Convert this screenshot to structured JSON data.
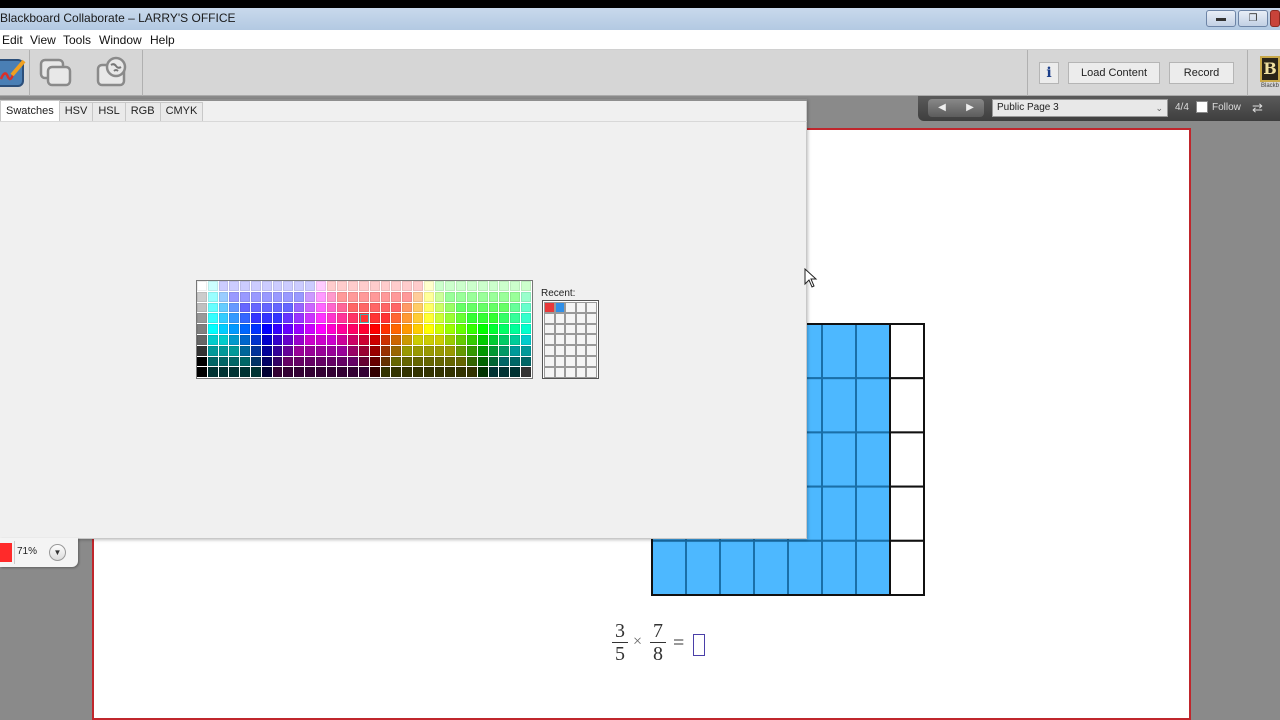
{
  "window": {
    "title": "Blackboard Collaborate – LARRY'S OFFICE",
    "controls": [
      "minimize",
      "restore",
      "close"
    ]
  },
  "menu": {
    "items": [
      "Edit",
      "View",
      "Tools",
      "Window",
      "Help"
    ]
  },
  "toolbar": {
    "icons": [
      "whiteboard-icon",
      "application-sharing-icon",
      "web-tour-icon"
    ],
    "info_label": "i",
    "load_content_label": "Load Content",
    "record_label": "Record",
    "logo_text": "B",
    "logo_sub": "Blackb"
  },
  "navigation": {
    "prev_label": "◀",
    "next_label": "▶",
    "page_select_value": "Public Page 3",
    "page_count": "4/4",
    "follow_label": "Follow",
    "follow_checked": false
  },
  "color_chooser": {
    "tabs": [
      {
        "label": "Swatches",
        "active": true
      },
      {
        "label": "HSV",
        "active": false
      },
      {
        "label": "HSL",
        "active": false
      },
      {
        "label": "RGB",
        "active": false
      },
      {
        "label": "CMYK",
        "active": false
      }
    ],
    "selected_swatch": {
      "row": 3,
      "col": 15
    },
    "recent_label": "Recent:",
    "recent_colors": [
      "#e8383a",
      "#2f8fe8"
    ],
    "swatches": [
      [
        "#ffffff",
        "#ccffff",
        "#ccccff",
        "#ccccff",
        "#ccccff",
        "#ccccff",
        "#ccccff",
        "#ccccff",
        "#ccccff",
        "#ccccff",
        "#ccccff",
        "#ffccff",
        "#ffcccc",
        "#ffcccc",
        "#ffcccc",
        "#ffcccc",
        "#ffcccc",
        "#ffcccc",
        "#ffcccc",
        "#ffcccc",
        "#ffcccc",
        "#ffffcc",
        "#ccffcc",
        "#ccffcc",
        "#ccffcc",
        "#ccffcc",
        "#ccffcc",
        "#ccffcc",
        "#ccffcc",
        "#ccffcc",
        "#ccffcc"
      ],
      [
        "#cccccc",
        "#99ffff",
        "#99ccff",
        "#9999ff",
        "#9999ff",
        "#9999ff",
        "#9999ff",
        "#9999ff",
        "#9999ff",
        "#9999ff",
        "#cc99ff",
        "#ff99ff",
        "#ff99cc",
        "#ff9999",
        "#ff9999",
        "#ff9999",
        "#ff9999",
        "#ff9999",
        "#ff9999",
        "#ff9999",
        "#ffcc99",
        "#ffff99",
        "#ccff99",
        "#99ff99",
        "#99ff99",
        "#99ff99",
        "#99ff99",
        "#99ff99",
        "#99ff99",
        "#99ff99",
        "#99ffcc"
      ],
      [
        "#c0c0c0",
        "#66ffff",
        "#66ccff",
        "#6699ff",
        "#6666ff",
        "#6666ff",
        "#6666ff",
        "#6666ff",
        "#6666ff",
        "#9966ff",
        "#cc66ff",
        "#ff66ff",
        "#ff66cc",
        "#ff6699",
        "#ff6666",
        "#ff6666",
        "#ff6666",
        "#ff6666",
        "#ff6666",
        "#ff9966",
        "#ffcc66",
        "#ffff66",
        "#ccff66",
        "#99ff66",
        "#66ff66",
        "#66ff66",
        "#66ff66",
        "#66ff66",
        "#66ff66",
        "#66ff99",
        "#66ffcc"
      ],
      [
        "#999999",
        "#33ffff",
        "#33ccff",
        "#3399ff",
        "#3366ff",
        "#3333ff",
        "#3333ff",
        "#3333ff",
        "#6633ff",
        "#9933ff",
        "#cc33ff",
        "#ff33ff",
        "#ff33cc",
        "#ff3399",
        "#ff3366",
        "#ff3333",
        "#ff3333",
        "#ff3333",
        "#ff6633",
        "#ff9933",
        "#ffcc33",
        "#ffff33",
        "#ccff33",
        "#99ff33",
        "#66ff33",
        "#33ff33",
        "#33ff33",
        "#33ff33",
        "#33ff66",
        "#33ff99",
        "#33ffcc"
      ],
      [
        "#808080",
        "#00ffff",
        "#00ccff",
        "#0099ff",
        "#0066ff",
        "#0033ff",
        "#0000ff",
        "#3300ff",
        "#6600ff",
        "#9900ff",
        "#cc00ff",
        "#ff00ff",
        "#ff00cc",
        "#ff0099",
        "#ff0066",
        "#ff0033",
        "#ff0000",
        "#ff3300",
        "#ff6600",
        "#ff9900",
        "#ffcc00",
        "#ffff00",
        "#ccff00",
        "#99ff00",
        "#66ff00",
        "#33ff00",
        "#00ff00",
        "#00ff33",
        "#00ff66",
        "#00ff99",
        "#00ffcc"
      ],
      [
        "#666666",
        "#00cccc",
        "#00cccc",
        "#0099cc",
        "#0066cc",
        "#0033cc",
        "#0000cc",
        "#3300cc",
        "#6600cc",
        "#9900cc",
        "#cc00cc",
        "#cc00cc",
        "#cc00cc",
        "#cc0099",
        "#cc0066",
        "#cc0033",
        "#cc0000",
        "#cc3300",
        "#cc6600",
        "#cc9900",
        "#cccc00",
        "#cccc00",
        "#cccc00",
        "#99cc00",
        "#66cc00",
        "#33cc00",
        "#00cc00",
        "#00cc33",
        "#00cc66",
        "#00cc99",
        "#00cccc"
      ],
      [
        "#333333",
        "#009999",
        "#009999",
        "#009999",
        "#006699",
        "#003399",
        "#000099",
        "#330099",
        "#660099",
        "#990099",
        "#990099",
        "#990099",
        "#990099",
        "#990099",
        "#990066",
        "#990033",
        "#990000",
        "#993300",
        "#996600",
        "#999900",
        "#999900",
        "#999900",
        "#999900",
        "#999900",
        "#669900",
        "#339900",
        "#009900",
        "#009933",
        "#009966",
        "#009999",
        "#009999"
      ],
      [
        "#000000",
        "#006666",
        "#006666",
        "#006666",
        "#006666",
        "#003366",
        "#000066",
        "#330066",
        "#660066",
        "#660066",
        "#660066",
        "#660066",
        "#660066",
        "#660066",
        "#660066",
        "#660033",
        "#660000",
        "#663300",
        "#666600",
        "#666600",
        "#666600",
        "#666600",
        "#666600",
        "#666600",
        "#666600",
        "#336600",
        "#006600",
        "#006633",
        "#006666",
        "#006666",
        "#006666"
      ],
      [
        "#000000",
        "#003333",
        "#003333",
        "#003333",
        "#003333",
        "#003333",
        "#000033",
        "#330033",
        "#330033",
        "#330033",
        "#330033",
        "#330033",
        "#330033",
        "#330033",
        "#330033",
        "#330033",
        "#330000",
        "#333300",
        "#333300",
        "#333300",
        "#333300",
        "#333300",
        "#333300",
        "#333300",
        "#333300",
        "#333300",
        "#003300",
        "#003333",
        "#003333",
        "#003333",
        "#333333"
      ]
    ]
  },
  "properties": {
    "fill_color": "#ff2a2a",
    "opacity": "71%"
  },
  "whiteboard": {
    "border_color": "#c0262c",
    "grid": {
      "rows": 5,
      "cols": 8,
      "shaded_cols": 7,
      "fill_color": "#4db8ff",
      "line_color": "#1a6fa8"
    },
    "equation": {
      "frac1": {
        "num": "3",
        "den": "5"
      },
      "operator": "×",
      "frac2": {
        "num": "7",
        "den": "8"
      },
      "equals": "="
    }
  }
}
